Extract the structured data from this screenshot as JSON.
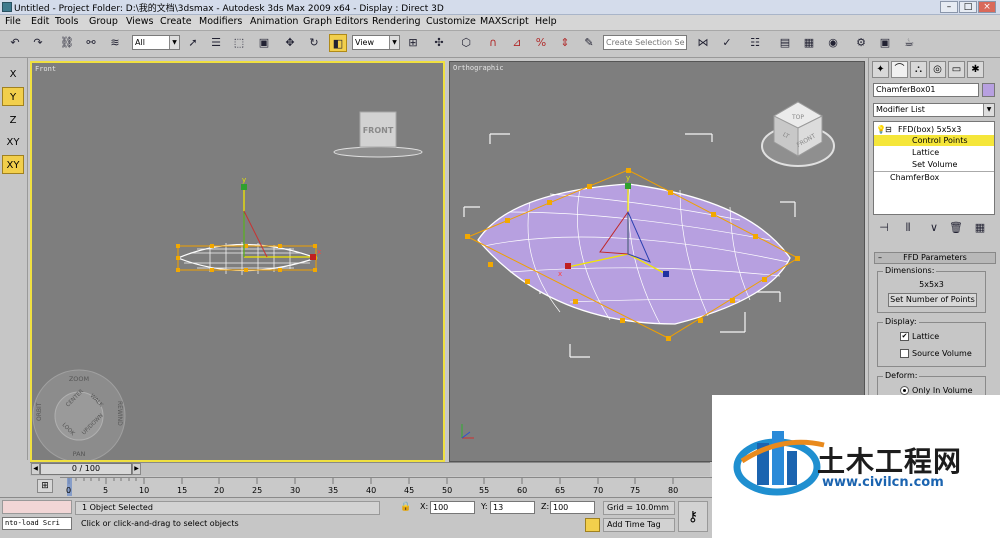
{
  "titlebar": {
    "text": "Untitled    - Project Folder: D:\\我的文档\\3dsmax    - Autodesk 3ds Max  2009 x64    - Display : Direct 3D",
    "min": "–",
    "max": "□",
    "close": "×"
  },
  "menu": [
    "File",
    "Edit",
    "Tools",
    "Group",
    "Views",
    "Create",
    "Modifiers",
    "Animation",
    "Graph Editors",
    "Rendering",
    "Customize",
    "MAXScript",
    "Help"
  ],
  "toolbar": {
    "filter": "All",
    "refcoord": "View",
    "selection_set_placeholder": "Create Selection Se"
  },
  "axis_constraints": [
    "X",
    "Y",
    "Z",
    "XY",
    "XY"
  ],
  "viewports": {
    "front": {
      "label": "Front",
      "viewcube": "FRONT",
      "wheel": {
        "zoom": "ZOOM",
        "orbit": "ORBIT",
        "center": "CENTER",
        "walk": "WALK",
        "rewind": "REWIND",
        "look": "LOOK",
        "updown": "UP/DOWN",
        "pan": "PAN"
      },
      "axis_y": "y",
      "axis_x": "x"
    },
    "ortho": {
      "label": "Orthographic",
      "cube_top": "TOP",
      "cube_front": "FRONT",
      "cube_left": "LT",
      "axis_y": "y",
      "axis_x": "x"
    }
  },
  "command_panel": {
    "object_name": "ChamferBox01",
    "modifier_list": "Modifier List",
    "stack": [
      "FFD(box) 5x5x3",
      "Control Points",
      "Lattice",
      "Set Volume",
      "ChamferBox"
    ],
    "rollout": "FFD Parameters",
    "dimensions_label": "Dimensions:",
    "dimensions_value": "5x5x3",
    "set_points_button": "Set Number of Points",
    "display_label": "Display:",
    "lattice": "Lattice",
    "source_volume": "Source Volume",
    "deform_label": "Deform:",
    "only_in_volume": "Only In Volume",
    "colors": {
      "object": "#b7a0e0",
      "highlight": "#f5e63a"
    }
  },
  "timeline": {
    "slider": "0 / 100",
    "ticks": [
      "0",
      "5",
      "10",
      "15",
      "20",
      "25",
      "30",
      "35",
      "40",
      "45",
      "50",
      "55",
      "60",
      "65",
      "70",
      "75",
      "80"
    ]
  },
  "status": {
    "selected": "1 Object Selected",
    "prompt": "Click or click-and-drag to select objects",
    "script": "nto-load Scri",
    "x_label": "X:",
    "x": "100",
    "y_label": "Y:",
    "y": "13",
    "z_label": "Z:",
    "z": "100",
    "grid": "Grid = 10.0mm",
    "add_time_tag": "Add Time Tag"
  },
  "watermark": {
    "cn": "土木工程网",
    "url": "www.civilcn.com"
  }
}
